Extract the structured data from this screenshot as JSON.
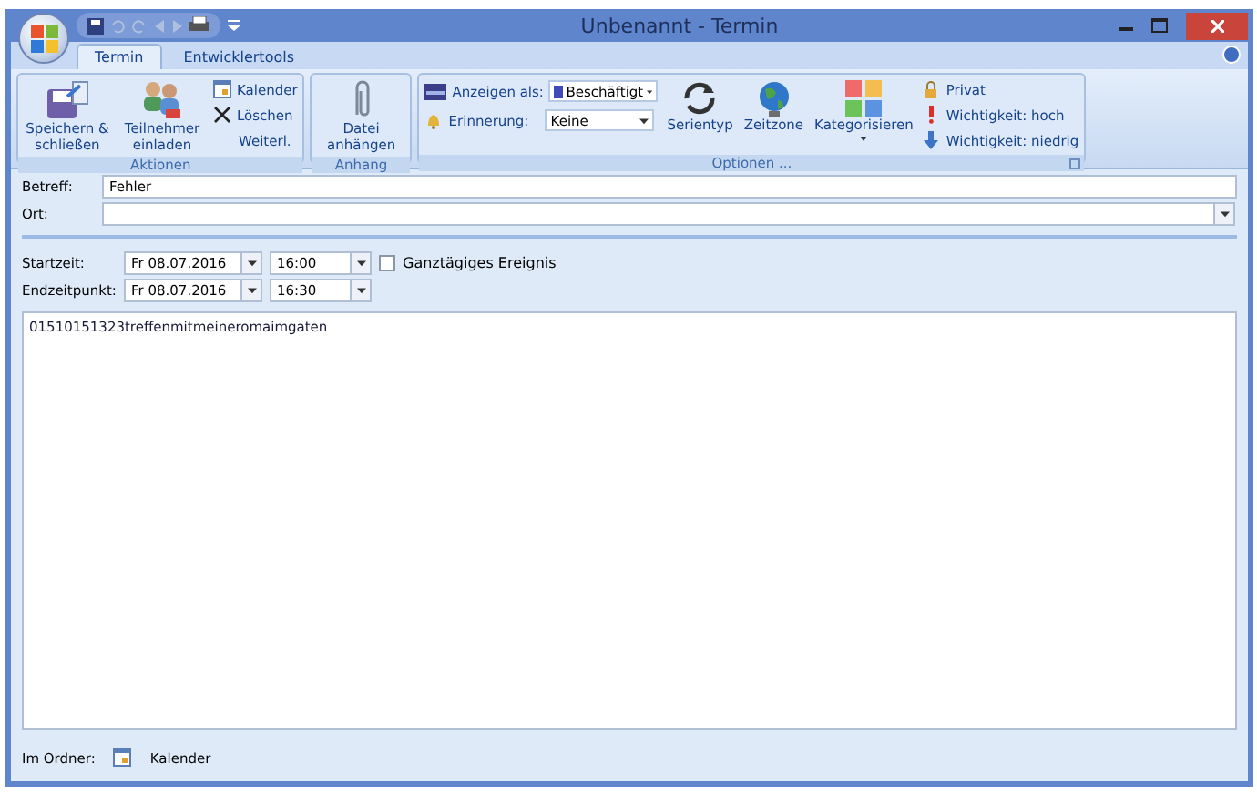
{
  "window": {
    "title": "Unbenannt - Termin"
  },
  "tabs": [
    {
      "label": "Termin",
      "selected": true
    },
    {
      "label": "Entwicklertools",
      "selected": false
    }
  ],
  "ribbon": {
    "groups": [
      {
        "label": "Aktionen",
        "large": [
          {
            "label": "Speichern & schließen",
            "kind": "save"
          },
          {
            "label": "Teilnehmer einladen",
            "kind": "people"
          }
        ],
        "small": [
          {
            "label": "Kalender",
            "kind": "calendar"
          },
          {
            "label": "Löschen",
            "kind": "delete"
          },
          {
            "label": "Weiterl.",
            "kind": "text"
          }
        ]
      },
      {
        "label": "Anhang",
        "large": [
          {
            "label": "Datei anhängen",
            "kind": "clip"
          }
        ]
      },
      {
        "label": "Optionen ...",
        "fields": [
          {
            "label": "Anzeigen als:",
            "value": "Beschäftigt",
            "kind": "show"
          },
          {
            "label": "Erinnerung:",
            "value": "Keine",
            "kind": "bell"
          }
        ],
        "large": [
          {
            "label": "Serientyp",
            "kind": "recur"
          },
          {
            "label": "Zeitzone",
            "kind": "globe"
          },
          {
            "label": "Kategorisieren",
            "kind": "categories"
          }
        ],
        "small": [
          {
            "label": "Privat",
            "kind": "lock"
          },
          {
            "label": "Wichtigkeit: hoch",
            "kind": "high"
          },
          {
            "label": "Wichtigkeit: niedrig",
            "kind": "low"
          }
        ]
      }
    ]
  },
  "form": {
    "subject": {
      "label": "Betreff:",
      "value": "Fehler"
    },
    "location": {
      "label": "Ort:"
    },
    "start": {
      "label": "Startzeit:",
      "date": "Fr 08.07.2016",
      "time": "16:00"
    },
    "end": {
      "label": "Endzeitpunkt:",
      "date": "Fr 08.07.2016",
      "time": "16:30"
    },
    "all_day": {
      "label": "Ganztägiges Ereignis",
      "checked": false
    },
    "body": "01510151323treffenmitmeineromaimgaten"
  },
  "folder": {
    "label": "Im Ordner:",
    "value": "Kalender"
  }
}
